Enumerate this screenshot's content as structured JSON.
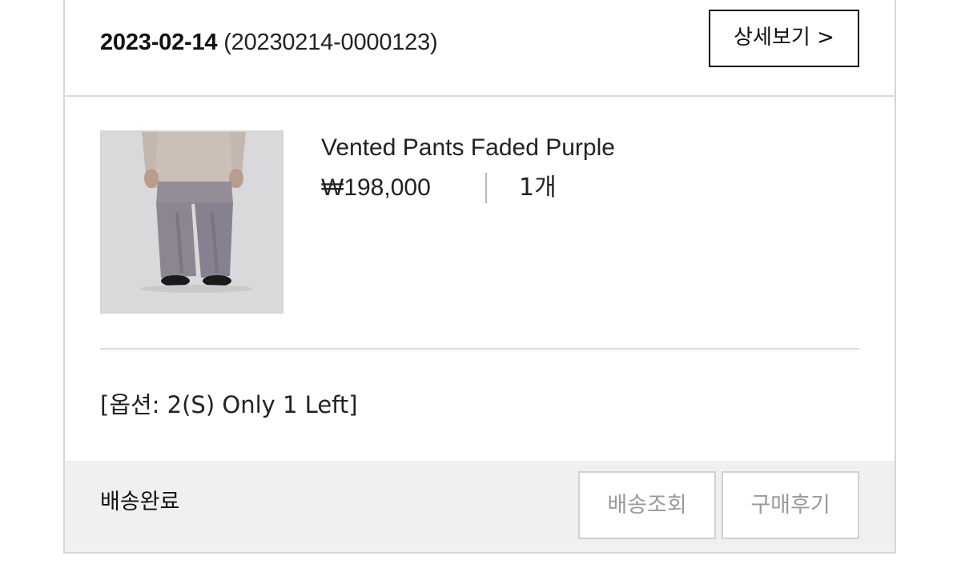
{
  "order": {
    "date": "2023-02-14",
    "number": "(20230214-0000123)",
    "detail_label": "상세보기 >"
  },
  "product": {
    "image_icon": "pants-photo",
    "name": "Vented Pants Faded Purple",
    "price": "₩198,000",
    "quantity": "1개",
    "option": "[옵션: 2(S) Only 1 Left]"
  },
  "footer": {
    "status": "배송완료",
    "track_label": "배송조회",
    "review_label": "구매후기"
  },
  "colors": {
    "border": "#d6d6d6",
    "footer_bg": "#f0f0f0",
    "disabled_text": "#9a9a9a",
    "pants": "#8d8690"
  }
}
